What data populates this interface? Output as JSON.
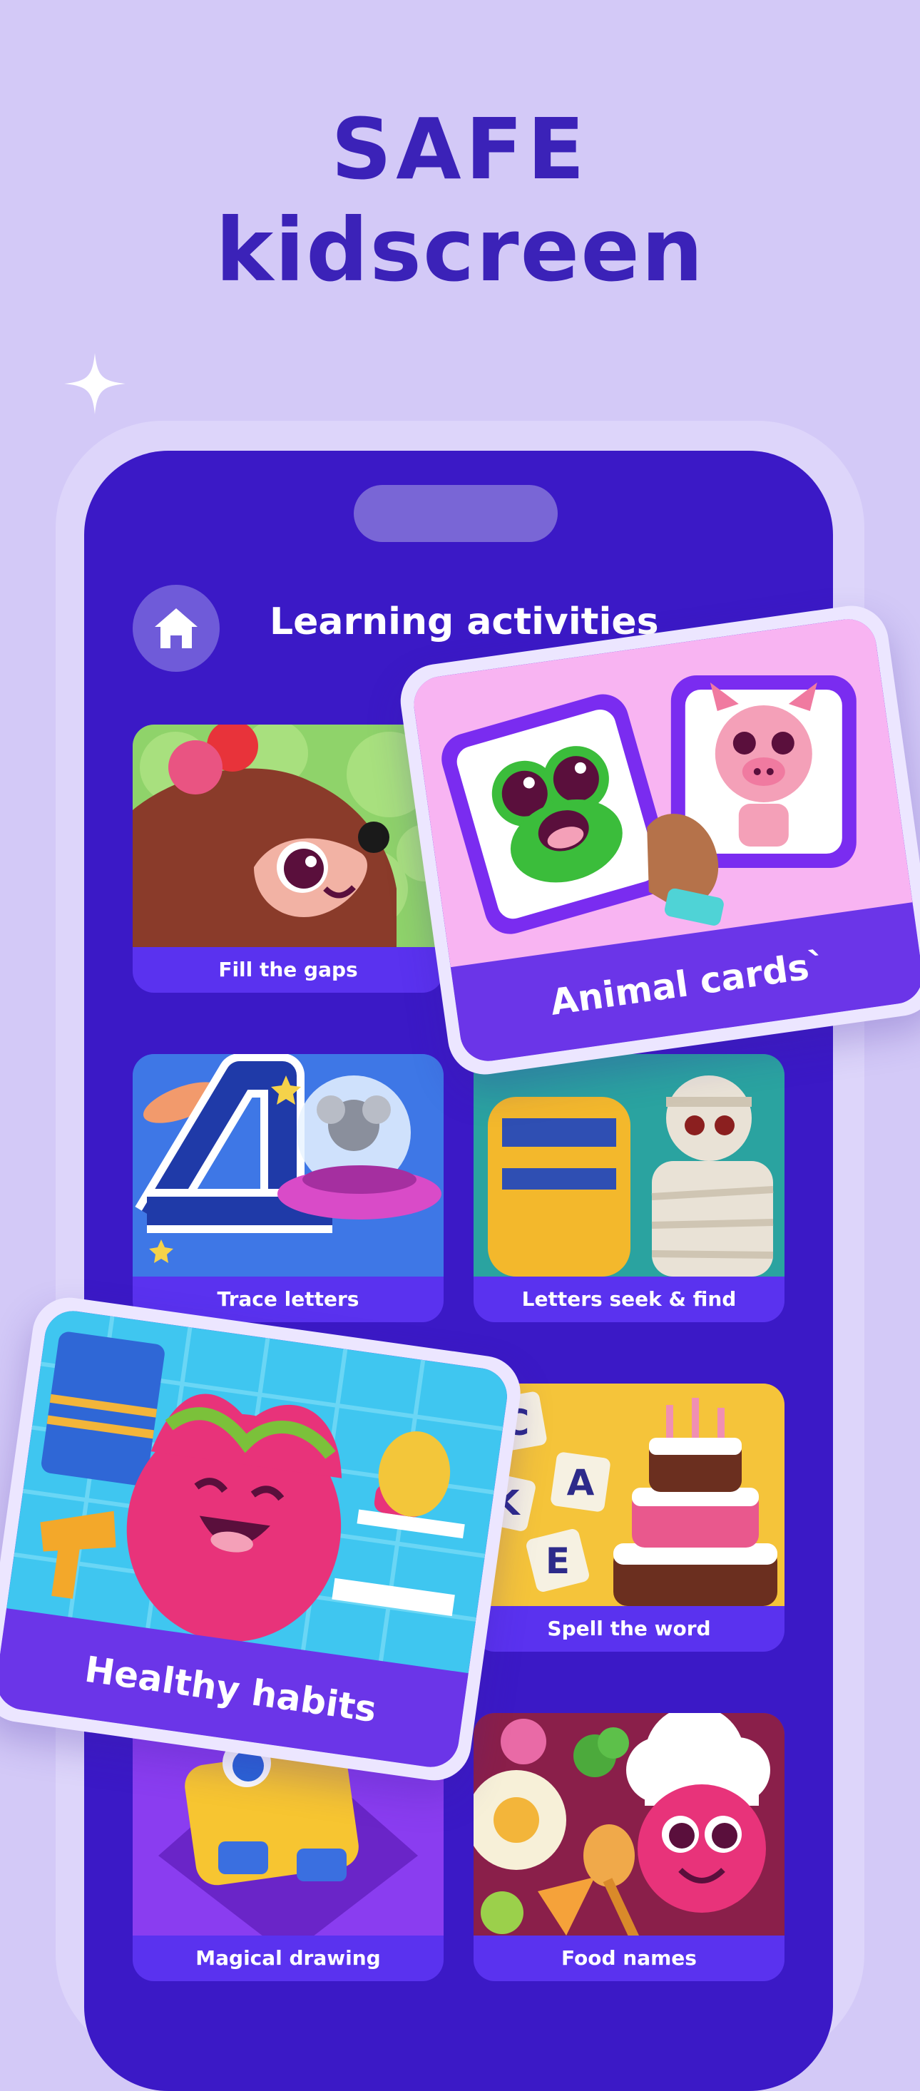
{
  "hero": {
    "line1": "SAFE",
    "line2": "kidscreen"
  },
  "screen": {
    "title": "Learning activities"
  },
  "tiles": [
    {
      "label": "Fill the gaps"
    },
    {
      "label": "Trace letters"
    },
    {
      "label": "Letters seek & find"
    },
    {
      "label": "Spell the word"
    },
    {
      "label": "Magical drawing"
    },
    {
      "label": "Food names"
    }
  ],
  "featured": [
    {
      "label": "Animal cards`"
    },
    {
      "label": "Healthy habits"
    }
  ],
  "spell_letters": [
    "C",
    "A",
    "K",
    "E"
  ],
  "icons": {
    "home": "home-icon",
    "sparkle": "sparkle-icon"
  },
  "colors": {
    "background": "#d3c9f7",
    "brand": "#3b22b8",
    "screen": "#3b19c6",
    "tile_label": "#5a32ef"
  }
}
